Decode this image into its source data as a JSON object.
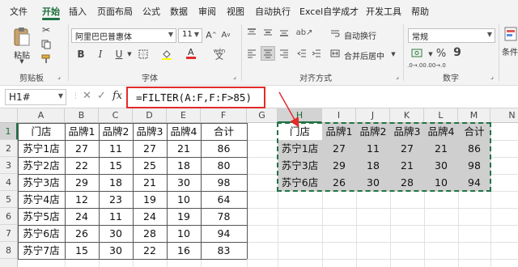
{
  "menu": {
    "tabs": [
      "文件",
      "开始",
      "插入",
      "页面布局",
      "公式",
      "数据",
      "审阅",
      "视图",
      "自动执行",
      "Excel自学成才",
      "开发工具",
      "帮助"
    ],
    "active_index": 1
  },
  "ribbon": {
    "paste_label": "粘贴",
    "clipboard_label": "剪贴板",
    "font_name": "阿里巴巴普惠体",
    "font_size": "11",
    "font_group_label": "字体",
    "bold": "B",
    "italic": "I",
    "underline": "U",
    "wen": "wén",
    "wrap_text_label": "自动换行",
    "merge_label": "合并后居中",
    "align_group_label": "对齐方式",
    "number_format": "常规",
    "percent": "%",
    "comma": "9",
    "number_group_label": "数字",
    "cond_label": "条件"
  },
  "formula_bar": {
    "name_box": "H1#",
    "fx": "fx",
    "formula": "=FILTER(A:F,F:F>85)"
  },
  "grid": {
    "columns": [
      "A",
      "B",
      "C",
      "D",
      "E",
      "F",
      "G",
      "H",
      "I",
      "J",
      "K",
      "L",
      "M",
      "N"
    ],
    "rows": [
      "1",
      "2",
      "3",
      "4",
      "5",
      "6",
      "7",
      "8"
    ],
    "source_headers": [
      "门店",
      "品牌1",
      "品牌2",
      "品牌3",
      "品牌4",
      "合计"
    ],
    "source_rows": [
      [
        "苏宁1店",
        "27",
        "11",
        "27",
        "21",
        "86"
      ],
      [
        "苏宁2店",
        "22",
        "15",
        "25",
        "18",
        "80"
      ],
      [
        "苏宁3店",
        "29",
        "18",
        "21",
        "30",
        "98"
      ],
      [
        "苏宁4店",
        "12",
        "23",
        "19",
        "10",
        "64"
      ],
      [
        "苏宁5店",
        "24",
        "11",
        "24",
        "19",
        "78"
      ],
      [
        "苏宁6店",
        "26",
        "30",
        "28",
        "10",
        "94"
      ],
      [
        "苏宁7店",
        "15",
        "30",
        "22",
        "16",
        "83"
      ]
    ],
    "result_headers": [
      "门店",
      "品牌1",
      "品牌2",
      "品牌3",
      "品牌4",
      "合计"
    ],
    "result_rows": [
      [
        "苏宁1店",
        "27",
        "11",
        "27",
        "21",
        "86"
      ],
      [
        "苏宁3店",
        "29",
        "18",
        "21",
        "30",
        "98"
      ],
      [
        "苏宁6店",
        "26",
        "30",
        "28",
        "10",
        "94"
      ]
    ]
  },
  "colors": {
    "accent": "#217346",
    "highlight_border": "#e32b2b",
    "arrow": "#e32b2b",
    "result_fill": "#cfcfcf"
  }
}
